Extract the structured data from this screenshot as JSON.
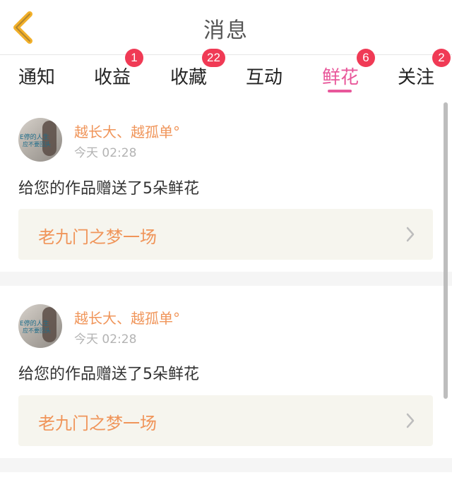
{
  "header": {
    "title": "消息"
  },
  "tabs": [
    {
      "label": "通知",
      "badge": ""
    },
    {
      "label": "收益",
      "badge": "1"
    },
    {
      "label": "收藏",
      "badge": "22"
    },
    {
      "label": "互动",
      "badge": ""
    },
    {
      "label": "鲜花",
      "badge": "6",
      "active": true
    },
    {
      "label": "关注",
      "badge": "2"
    }
  ],
  "feed": {
    "items": [
      {
        "username": "越长大、越孤单°",
        "time": "今天 02:28",
        "message": "给您的作品赠送了5朵鲜花",
        "work_title": "老九门之梦一场"
      },
      {
        "username": "越长大、越孤单°",
        "time": "今天 02:28",
        "message": "给您的作品赠送了5朵鲜花",
        "work_title": "老九门之梦一场"
      }
    ]
  },
  "colors": {
    "accent": "#e8579a",
    "badge": "#f03a55",
    "username": "#f0955a",
    "back_arrow": "#f2b02a"
  },
  "icons": {
    "back": "chevron-left-icon",
    "link": "chevron-right-icon"
  }
}
